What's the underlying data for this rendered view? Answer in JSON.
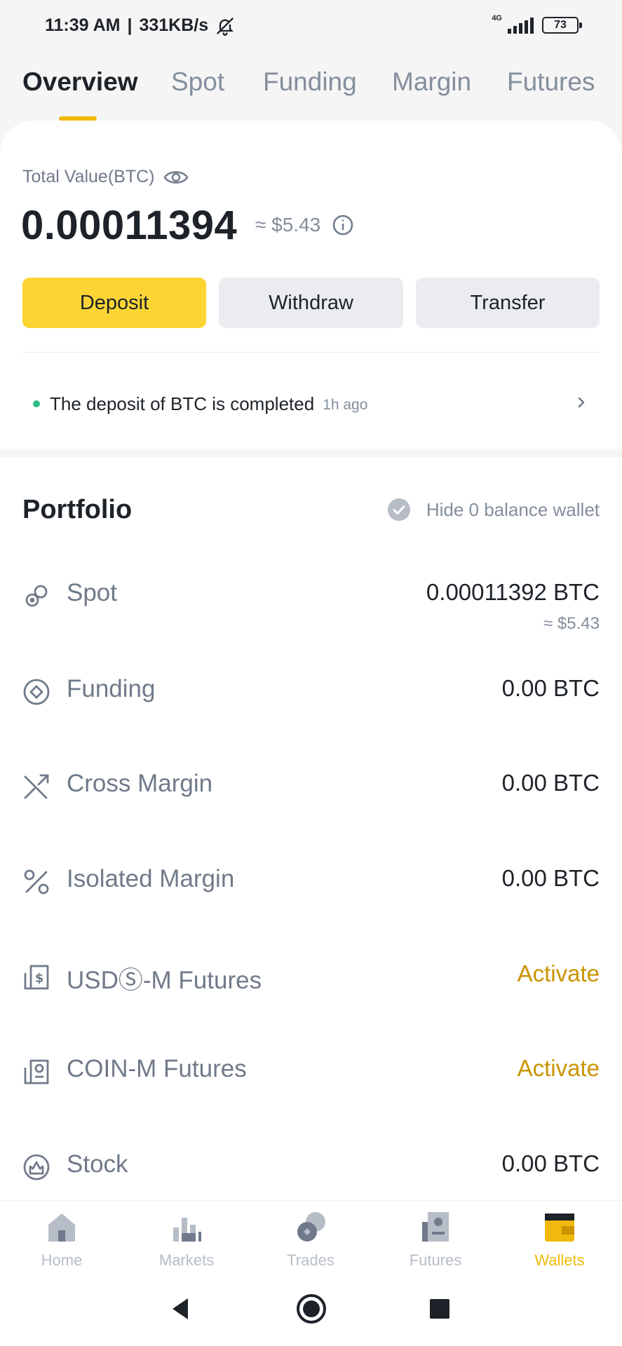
{
  "status_bar": {
    "time": "11:39 AM",
    "speed": "331KB/s",
    "network": "4G",
    "battery": "73"
  },
  "tabs": [
    {
      "label": "Overview",
      "active": true
    },
    {
      "label": "Spot"
    },
    {
      "label": "Funding"
    },
    {
      "label": "Margin"
    },
    {
      "label": "Futures"
    }
  ],
  "total": {
    "label": "Total Value(BTC)",
    "value": "0.00011394",
    "usd": "≈ $5.43"
  },
  "actions": {
    "deposit": "Deposit",
    "withdraw": "Withdraw",
    "transfer": "Transfer"
  },
  "notice": {
    "text": "The deposit of BTC is completed",
    "time": "1h ago"
  },
  "portfolio": {
    "title": "Portfolio",
    "hide_zero_label": "Hide 0 balance wallet",
    "rows": [
      {
        "label": "Spot",
        "value": "0.00011392 BTC",
        "sub": "≈ $5.43",
        "icon": "spot-icon"
      },
      {
        "label": "Funding",
        "value": "0.00 BTC",
        "icon": "funding-icon"
      },
      {
        "label": "Cross Margin",
        "value": "0.00 BTC",
        "icon": "cross-margin-icon"
      },
      {
        "label": "Isolated Margin",
        "value": "0.00 BTC",
        "icon": "isolated-margin-icon"
      },
      {
        "label": "USDⓈ-M Futures",
        "value": "Activate",
        "icon": "usds-futures-icon"
      },
      {
        "label": "COIN-M Futures",
        "value": "Activate",
        "icon": "coin-futures-icon"
      },
      {
        "label": "Stock",
        "value": "0.00 BTC",
        "icon": "stock-icon"
      }
    ]
  },
  "bottom_nav": [
    {
      "label": "Home",
      "icon": "home-icon"
    },
    {
      "label": "Markets",
      "icon": "markets-icon"
    },
    {
      "label": "Trades",
      "icon": "trades-icon"
    },
    {
      "label": "Futures",
      "icon": "futures-icon"
    },
    {
      "label": "Wallets",
      "icon": "wallet-icon",
      "active": true
    }
  ],
  "colors": {
    "brand_yellow": "#fcd535",
    "accent_yellow": "#f0b90b",
    "activate": "#c99400",
    "success_green": "#2ebd85",
    "text_primary": "#1e2329",
    "text_secondary": "#848e9c"
  }
}
